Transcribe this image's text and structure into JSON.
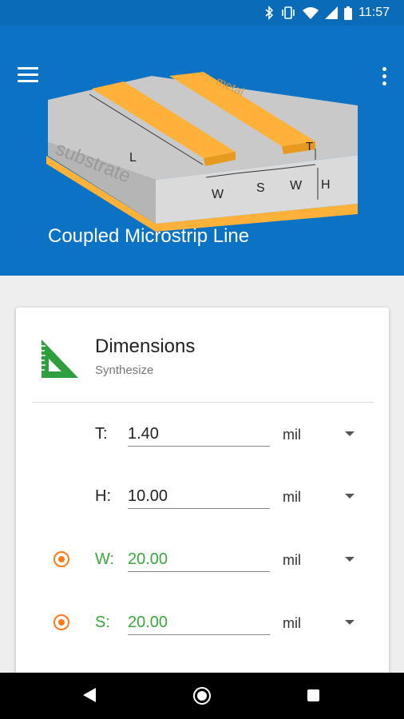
{
  "status": {
    "time": "11:57"
  },
  "header": {
    "title": "Coupled Microstrip Line",
    "diagram": {
      "metal": "metal",
      "substrate": "substrate",
      "L": "L",
      "W": "W",
      "S": "S",
      "T": "T",
      "H": "H"
    }
  },
  "card": {
    "title": "Dimensions",
    "subtitle": "Synthesize",
    "rows": [
      {
        "label": "T:",
        "value": "1.40",
        "unit": "mil",
        "selected": false
      },
      {
        "label": "H:",
        "value": "10.00",
        "unit": "mil",
        "selected": false
      },
      {
        "label": "W:",
        "value": "20.00",
        "unit": "mil",
        "selected": true
      },
      {
        "label": "S:",
        "value": "20.00",
        "unit": "mil",
        "selected": true
      }
    ]
  },
  "colors": {
    "header": "#0b72c4",
    "accent": "#ff7b1a",
    "active_text": "#3aa83a",
    "strip": "#ffb13a",
    "icon": "#2e9e3e"
  }
}
